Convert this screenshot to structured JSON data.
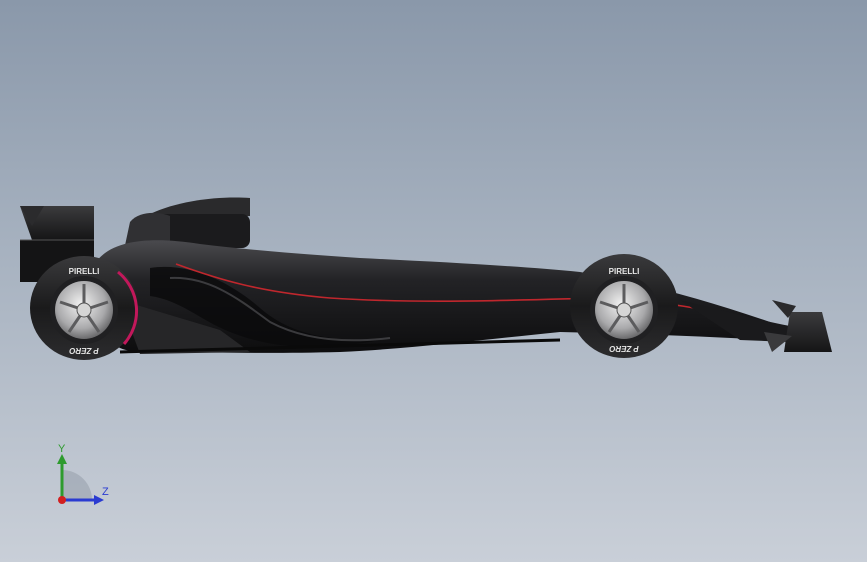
{
  "viewport": {
    "background_top": "#8a98aa",
    "background_bottom": "#c9cfd8"
  },
  "model": {
    "body_color": "#1c1c1e",
    "accent_stripe_color": "#c0272d",
    "rim_stripe_color": "#c2185b",
    "tire_brand": "PIRELLI",
    "tire_sidewall_text": "P ZERO"
  },
  "triad": {
    "y_label": "Y",
    "z_label": "Z",
    "y_color": "#2e9b2e",
    "z_color": "#2a3bd1",
    "x_color": "#d22020"
  }
}
